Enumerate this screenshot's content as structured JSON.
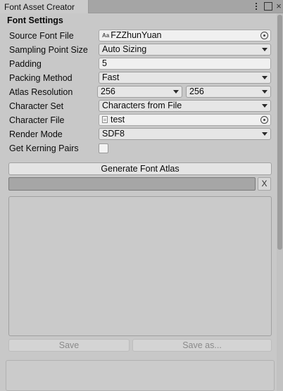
{
  "window": {
    "tab_title": "Font Asset Creator"
  },
  "section": {
    "title": "Font Settings"
  },
  "fields": {
    "source_font_file": {
      "label": "Source Font File",
      "value": "FZZhunYuan",
      "icon_text": "Aa",
      "icon": "font-icon"
    },
    "sampling_point_size": {
      "label": "Sampling Point Size",
      "value": "Auto Sizing"
    },
    "padding": {
      "label": "Padding",
      "value": "5"
    },
    "packing_method": {
      "label": "Packing Method",
      "value": "Fast"
    },
    "atlas_resolution": {
      "label": "Atlas Resolution",
      "width": "256",
      "height": "256"
    },
    "character_set": {
      "label": "Character Set",
      "value": "Characters from File"
    },
    "character_file": {
      "label": "Character File",
      "value": "test",
      "icon": "text-file-icon"
    },
    "render_mode": {
      "label": "Render Mode",
      "value": "SDF8"
    },
    "get_kerning_pairs": {
      "label": "Get Kerning Pairs",
      "checked": false
    }
  },
  "actions": {
    "generate_label": "Generate Font Atlas",
    "cancel_label": "X",
    "save_label": "Save",
    "save_as_label": "Save as..."
  },
  "progress": {
    "fraction": 0
  },
  "colors": {
    "progress_fill": "#5a88c7"
  }
}
